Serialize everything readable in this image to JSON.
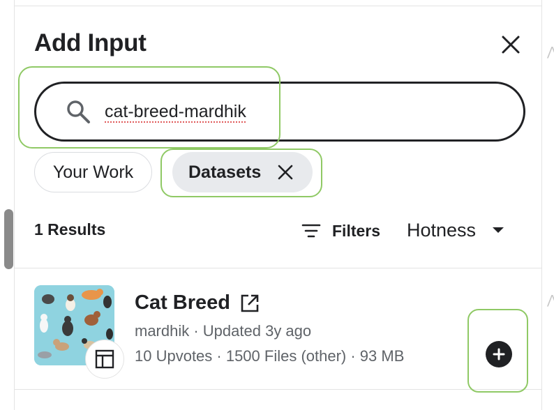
{
  "panel": {
    "title": "Add Input"
  },
  "search": {
    "value": "cat-breed-mardhik"
  },
  "chips": {
    "your_work": "Your Work",
    "datasets": "Datasets"
  },
  "results": {
    "count_label": "1 Results",
    "filters_label": "Filters",
    "sort_label": "Hotness"
  },
  "dataset": {
    "title": "Cat Breed",
    "owner": "mardhik",
    "updated": "Updated 3y ago",
    "meta_line": "mardhik · Updated 3y ago",
    "stats_line": "10 Upvotes · 1500 Files (other) · 93 MB",
    "type_icon": "table-icon"
  },
  "icons": {
    "close": "close-icon",
    "search": "search-icon",
    "chip_remove": "close-icon",
    "filters": "filter-icon",
    "sort": "caret-down-icon",
    "external": "external-link-icon",
    "add": "add-icon"
  },
  "colors": {
    "text": "#202124",
    "muted": "#5f6368",
    "chip_active_bg": "#e8eaed",
    "highlight": "#8fc965",
    "thumbnail_bg": "#8fd3e0"
  }
}
